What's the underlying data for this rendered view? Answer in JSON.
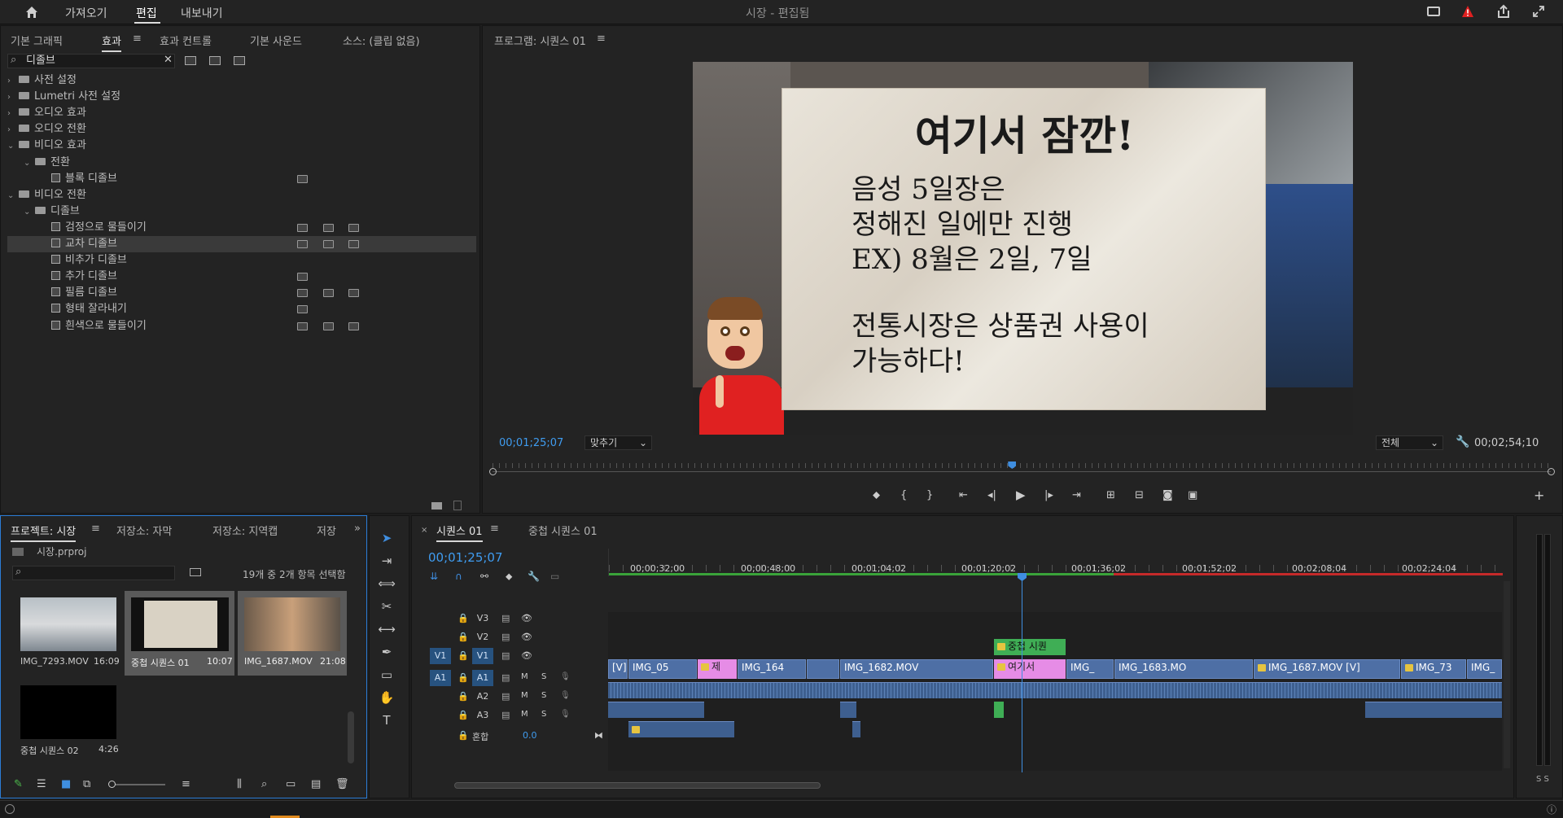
{
  "topbar": {
    "home_icon": "home-icon",
    "menu": [
      "가져오기",
      "편집",
      "내보내기"
    ],
    "active": "편집",
    "title": "시장 - 편집됨"
  },
  "effects_panel": {
    "tabs": [
      "기본 그래픽",
      "효과",
      "효과 컨트롤",
      "기본 사운드",
      "소스: (클립 없음)"
    ],
    "active_tab": "효과",
    "search_value": "디졸브",
    "tree": [
      {
        "label": "사전 설정",
        "type": "folder",
        "level": 0,
        "expanded": false
      },
      {
        "label": "Lumetri 사전 설정",
        "type": "folder",
        "level": 0,
        "expanded": false
      },
      {
        "label": "오디오 효과",
        "type": "folder",
        "level": 0,
        "expanded": false
      },
      {
        "label": "오디오 전환",
        "type": "folder",
        "level": 0,
        "expanded": false
      },
      {
        "label": "비디오 효과",
        "type": "folder",
        "level": 0,
        "expanded": true
      },
      {
        "label": "전환",
        "type": "folder",
        "level": 1,
        "expanded": true
      },
      {
        "label": "블록 디졸브",
        "type": "effect",
        "level": 2,
        "badges": 1
      },
      {
        "label": "비디오 전환",
        "type": "folder",
        "level": 0,
        "expanded": true
      },
      {
        "label": "디졸브",
        "type": "folder",
        "level": 1,
        "expanded": true
      },
      {
        "label": "검정으로 물들이기",
        "type": "effect",
        "level": 2,
        "badges": 3
      },
      {
        "label": "교차 디졸브",
        "type": "effect",
        "level": 2,
        "badges": 3,
        "selected": true
      },
      {
        "label": "비추가 디졸브",
        "type": "effect",
        "level": 2,
        "badges": 0
      },
      {
        "label": "추가 디졸브",
        "type": "effect",
        "level": 2,
        "badges": 1
      },
      {
        "label": "필름 디졸브",
        "type": "effect",
        "level": 2,
        "badges": 3
      },
      {
        "label": "형태 잘라내기",
        "type": "effect",
        "level": 2,
        "badges": 1
      },
      {
        "label": "흰색으로 물들이기",
        "type": "effect",
        "level": 2,
        "badges": 3
      }
    ]
  },
  "program_monitor": {
    "tab": "프로그램: 시퀀스 01",
    "timecode": "00;01;25;07",
    "fit": "맞추기",
    "quality": "전체",
    "duration": "00;02;54;10",
    "overlay": {
      "title": "여기서 잠깐!",
      "line1": "음성 5일장은",
      "line2": "정해진 일에만 진행",
      "line3": "EX) 8월은 2일, 7일",
      "line4": "전통시장은 상품권 사용이",
      "line5": "가능하다!"
    },
    "playhead_fraction": 0.491
  },
  "project_panel": {
    "tabs": [
      "프로젝트: 시장",
      "저장소: 자막",
      "저장소: 지역캡",
      "저장"
    ],
    "file": "시장.prproj",
    "selection_info": "19개 중 2개 항목 선택함",
    "items": [
      {
        "name": "IMG_7293.MOV",
        "duration": "16:09"
      },
      {
        "name": "중첩 시퀀스 01",
        "duration": "10:07"
      },
      {
        "name": "IMG_1687.MOV",
        "duration": "21:08"
      },
      {
        "name": "중첩 시퀀스 02",
        "duration": "4:26"
      }
    ]
  },
  "timeline": {
    "tabs": [
      "시퀀스 01",
      "중첩 시퀀스 01"
    ],
    "timecode": "00;01;25;07",
    "ruler": [
      "00;00;32;00",
      "00;00;48;00",
      "00;01;04;02",
      "00;01;20;02",
      "00;01;36;02",
      "00;01;52;02",
      "00;02;08;04",
      "00;02;24;04"
    ],
    "tracks": [
      "V3",
      "V2",
      "V1",
      "A1",
      "A2",
      "A3"
    ],
    "mix_label": "혼합",
    "mix_value": "0.0",
    "v1_clips": [
      "[V]",
      "IMG_05",
      "제",
      "IMG_164",
      "IMG_1682.MOV",
      "여기서",
      "IMG_",
      "IMG_1683.MO",
      "IMG_1687.MOV [V]",
      "IMG_73",
      "IMG_"
    ],
    "v2_clip": "중첩 시퀀"
  }
}
